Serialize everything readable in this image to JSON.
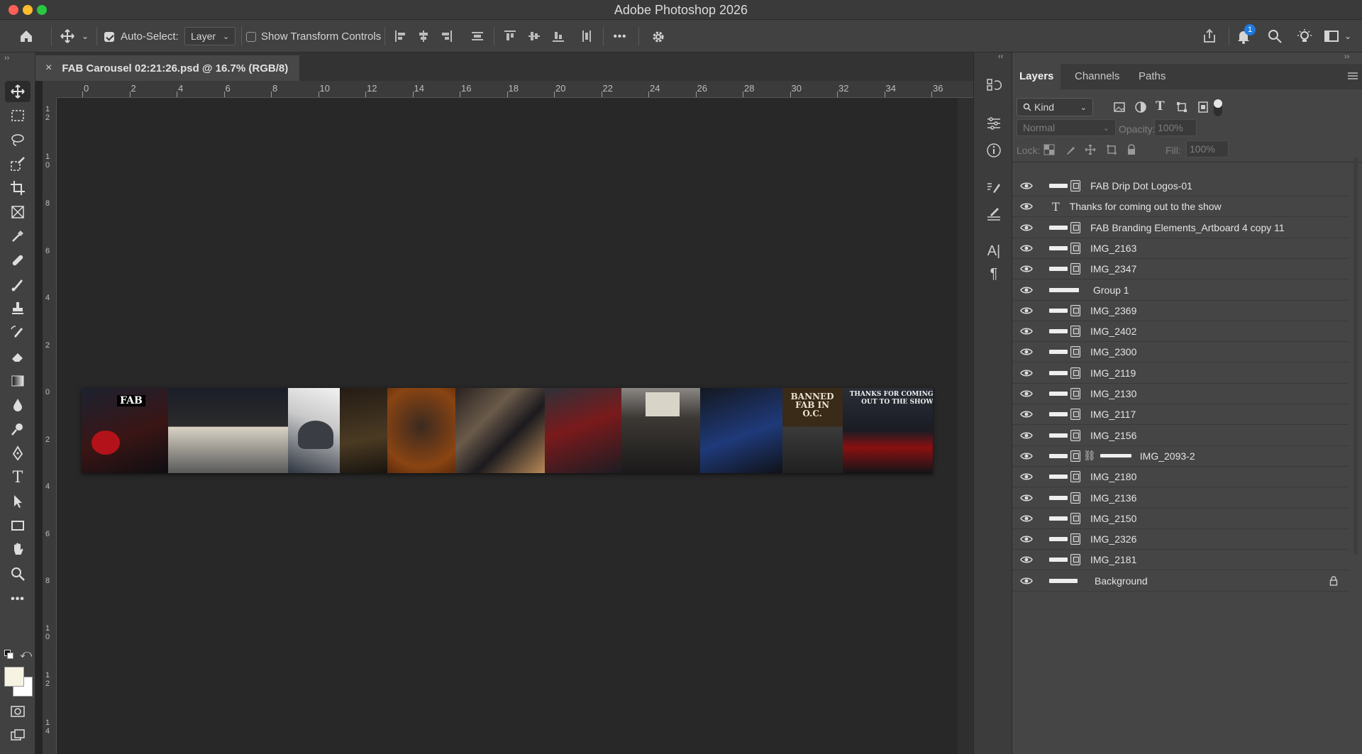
{
  "window": {
    "title": "Adobe Photoshop 2026"
  },
  "options_bar": {
    "auto_select_label": "Auto-Select:",
    "auto_select_checked": true,
    "auto_select_value": "Layer",
    "show_transform_label": "Show Transform Controls",
    "show_transform_checked": false,
    "more_label": "•••",
    "notification_count": "1"
  },
  "document": {
    "tab_title": "FAB Carousel 02:21:26.psd @ 16.7% (RGB/8)",
    "close_label": "×"
  },
  "rulers": {
    "top_ticks": [
      "0",
      "2",
      "4",
      "6",
      "8",
      "10",
      "12",
      "14",
      "16",
      "18",
      "20",
      "22",
      "24",
      "26",
      "28",
      "30",
      "32",
      "34",
      "36"
    ],
    "left_ticks": [
      "1\n2",
      "1\n0",
      "8",
      "6",
      "4",
      "2",
      "0",
      "2",
      "4",
      "6",
      "8",
      "1\n0",
      "1\n2",
      "1\n4"
    ]
  },
  "artboard_text": {
    "logo": "FAB",
    "banner": "BANNED FAB IN O.C.",
    "closing": "THANKS FOR COMING OUT TO THE SHOW"
  },
  "layers_panel": {
    "tabs": [
      "Layers",
      "Channels",
      "Paths"
    ],
    "filter_kind": "Kind",
    "blend_mode": "Normal",
    "opacity_label": "Opacity:",
    "opacity_value": "100%",
    "lock_label": "Lock:",
    "fill_label": "Fill:",
    "fill_value": "100%",
    "layers": [
      {
        "name": "FAB Drip Dot Logos-01",
        "kind": "smart"
      },
      {
        "name": "Thanks for coming out to the show",
        "kind": "text"
      },
      {
        "name": "FAB Branding Elements_Artboard 4 copy 11",
        "kind": "smart"
      },
      {
        "name": "IMG_2163",
        "kind": "smart"
      },
      {
        "name": "IMG_2347",
        "kind": "smart"
      },
      {
        "name": "Group 1",
        "kind": "group"
      },
      {
        "name": "IMG_2369",
        "kind": "smart"
      },
      {
        "name": "IMG_2402",
        "kind": "smart"
      },
      {
        "name": "IMG_2300",
        "kind": "smart"
      },
      {
        "name": "IMG_2119",
        "kind": "smart"
      },
      {
        "name": "IMG_2130",
        "kind": "smart"
      },
      {
        "name": "IMG_2117",
        "kind": "smart"
      },
      {
        "name": "IMG_2156",
        "kind": "smart"
      },
      {
        "name": "IMG_2093-2",
        "kind": "masked"
      },
      {
        "name": "IMG_2180",
        "kind": "smart"
      },
      {
        "name": "IMG_2136",
        "kind": "smart"
      },
      {
        "name": "IMG_2150",
        "kind": "smart"
      },
      {
        "name": "IMG_2326",
        "kind": "smart"
      },
      {
        "name": "IMG_2181",
        "kind": "smart"
      },
      {
        "name": "Background",
        "kind": "background",
        "locked": true
      }
    ]
  },
  "colors": {
    "accent_notification": "#1f7ae0",
    "panel_bg": "#454545",
    "canvas_bg": "#282828"
  }
}
